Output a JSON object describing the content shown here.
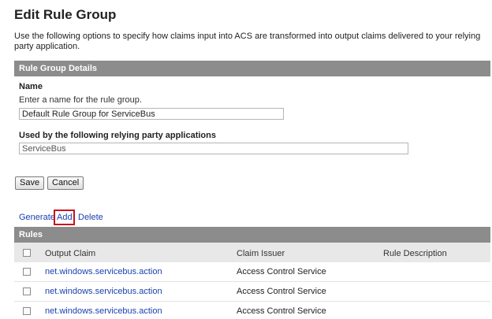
{
  "page": {
    "title": "Edit Rule Group",
    "intro": "Use the following options to specify how claims input into ACS are transformed into output claims delivered to your relying party application."
  },
  "details": {
    "header": "Rule Group Details",
    "name_label": "Name",
    "name_hint": "Enter a name for the rule group.",
    "name_value": "Default Rule Group for ServiceBus",
    "used_by_label": "Used by the following relying party applications",
    "used_by_value": "ServiceBus"
  },
  "buttons": {
    "save": "Save",
    "cancel": "Cancel"
  },
  "actions": {
    "generate": "Generate",
    "add": "Add",
    "delete": "Delete"
  },
  "rules": {
    "header": "Rules",
    "columns": [
      "Output Claim",
      "Claim Issuer",
      "Rule Description"
    ],
    "rows": [
      {
        "output_claim": "net.windows.servicebus.action",
        "claim_issuer": "Access Control Service",
        "description": ""
      },
      {
        "output_claim": "net.windows.servicebus.action",
        "claim_issuer": "Access Control Service",
        "description": ""
      },
      {
        "output_claim": "net.windows.servicebus.action",
        "claim_issuer": "Access Control Service",
        "description": ""
      }
    ]
  },
  "colors": {
    "header_bg": "#8c8c8c",
    "link": "#1a3fb0",
    "highlight": "#c8141e"
  }
}
